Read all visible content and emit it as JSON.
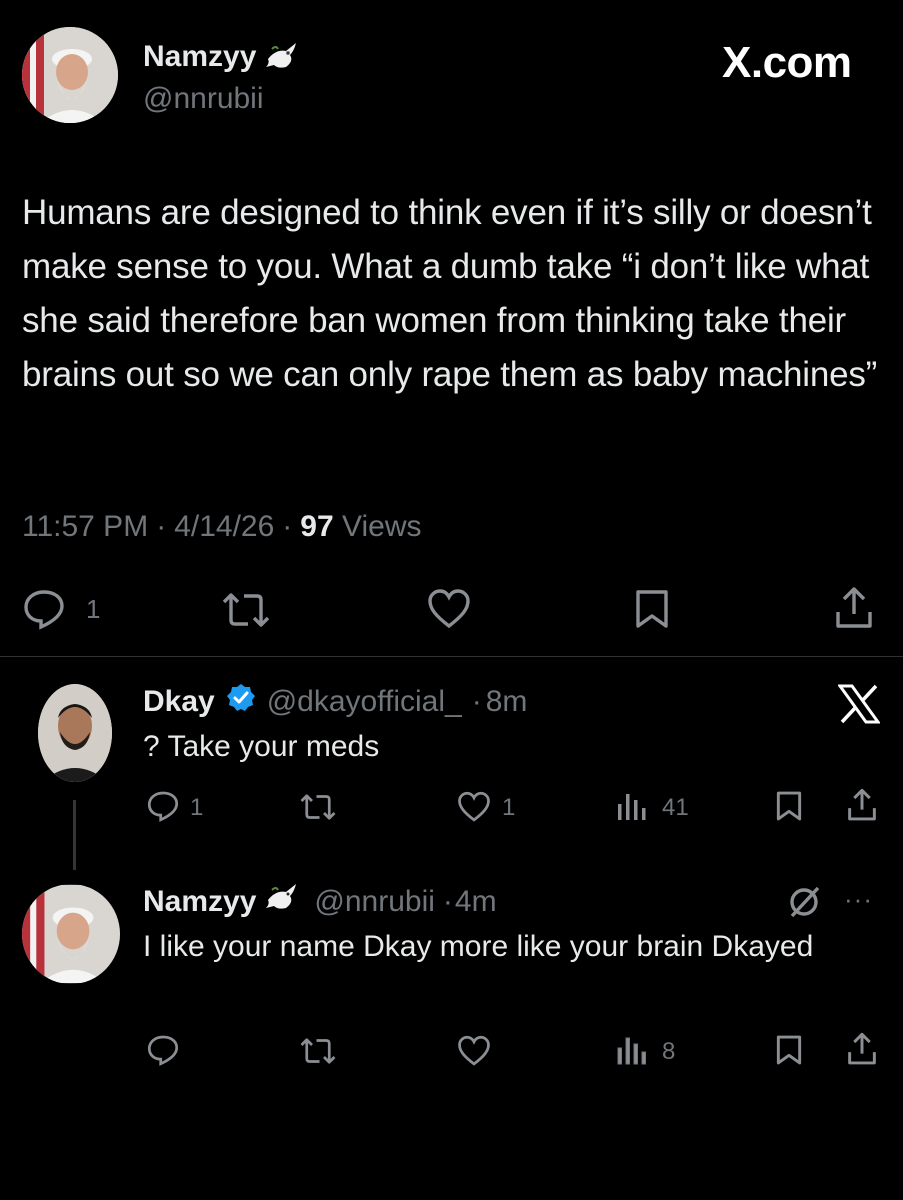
{
  "main_tweet": {
    "author_name": "Namzyy",
    "author_handle": "@nnrubii",
    "badge": "dove-emoji",
    "site_label": "X.com",
    "text": "Humans are designed to think even if it’s silly or doesn’t make sense to you. What a dumb take “i don’t like what she said therefore ban women from thinking take their brains out so we can only rape them as baby machines”",
    "time": "11:57 PM",
    "date": "4/14/26",
    "views_count": "97",
    "views_label": "Views",
    "reply_count": "1"
  },
  "reply1": {
    "author_name": "Dkay",
    "author_handle": "@dkayofficial_",
    "age": "8m",
    "verified": true,
    "text": "? Take your meds",
    "reply_count": "1",
    "like_count": "1",
    "views": "41"
  },
  "reply2": {
    "author_name": "Namzyy",
    "author_handle": "@nnrubii",
    "age": "4m",
    "text": "I like your name Dkay more like your brain Dkayed",
    "views": "8"
  },
  "colors": {
    "background": "#000000",
    "text": "#e7e9ea",
    "secondary": "#71767b",
    "verified": "#1d9bf0"
  }
}
